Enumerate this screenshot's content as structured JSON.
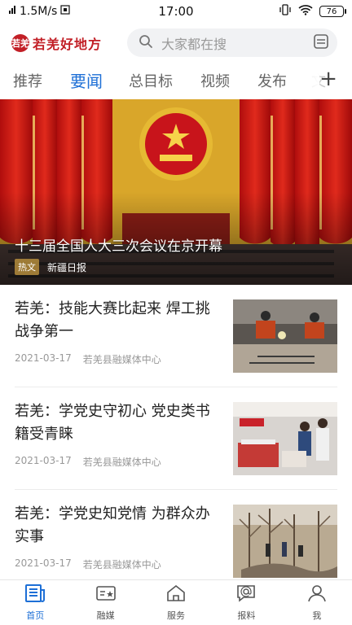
{
  "status_bar": {
    "network_speed": "1.5M/s",
    "time": "17:00",
    "battery": "76"
  },
  "app": {
    "logo_badge": "若羌",
    "name": "若羌好地方"
  },
  "search": {
    "placeholder": "大家都在搜"
  },
  "tabs": [
    {
      "label": "推荐"
    },
    {
      "label": "要闻",
      "active": true
    },
    {
      "label": "总目标"
    },
    {
      "label": "视频"
    },
    {
      "label": "发布"
    },
    {
      "label": "文"
    }
  ],
  "hero": {
    "title": "十三届全国人大三次会议在京开幕",
    "tag": "热文",
    "source": "新疆日报"
  },
  "news": [
    {
      "title": "若羌：技能大赛比起来 焊工挑战争第一",
      "date": "2021-03-17",
      "source": "若羌县融媒体中心",
      "thumb": "welding-competition"
    },
    {
      "title": "若羌：学党史守初心 党史类书籍受青睐",
      "date": "2021-03-17",
      "source": "若羌县融媒体中心",
      "thumb": "bookstore"
    },
    {
      "title": "若羌：学党史知党情 为群众办实事",
      "date": "2021-03-17",
      "source": "若羌县融媒体中心",
      "thumb": "orchard-pruning"
    }
  ],
  "bottom_nav": [
    {
      "label": "首页",
      "icon": "news-icon",
      "active": true
    },
    {
      "label": "融媒",
      "icon": "media-card-icon"
    },
    {
      "label": "服务",
      "icon": "home-icon"
    },
    {
      "label": "报料",
      "icon": "report-icon"
    },
    {
      "label": "我",
      "icon": "person-icon"
    }
  ],
  "colors": {
    "brand_red": "#c21f26",
    "accent_blue": "#1d6fd6"
  }
}
